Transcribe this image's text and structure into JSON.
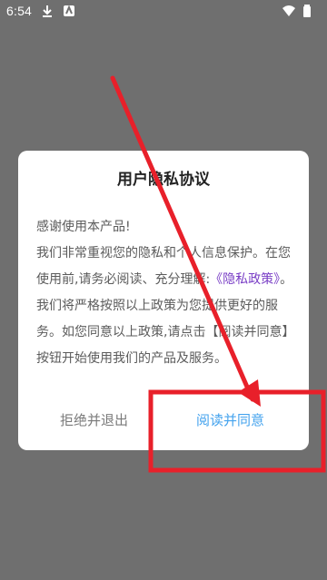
{
  "status_bar": {
    "time": "6:54",
    "icons": [
      "download-icon",
      "app-icon",
      "wifi-icon",
      "battery-icon"
    ]
  },
  "dialog": {
    "title": "用户隐私协议",
    "body": {
      "greeting": "感谢使用本产品!",
      "para1": "我们非常重视您的隐私和个人信息保护。在您使用前,请务必阅读、充分理解:",
      "policy_link": "《隐私政策》",
      "para2": "。我们将严格按照以上政策为您提供更好的服务。如您同意以上政策,请点击【阅读并同意】按钮开始使用我们的产品及服务。"
    },
    "buttons": {
      "reject": "拒绝并退出",
      "agree": "阅读并同意"
    }
  },
  "colors": {
    "backdrop": "#6f6f6f",
    "link": "#7a3fc6",
    "agree_button": "#44a3ee",
    "annotation": "#e8202a"
  }
}
